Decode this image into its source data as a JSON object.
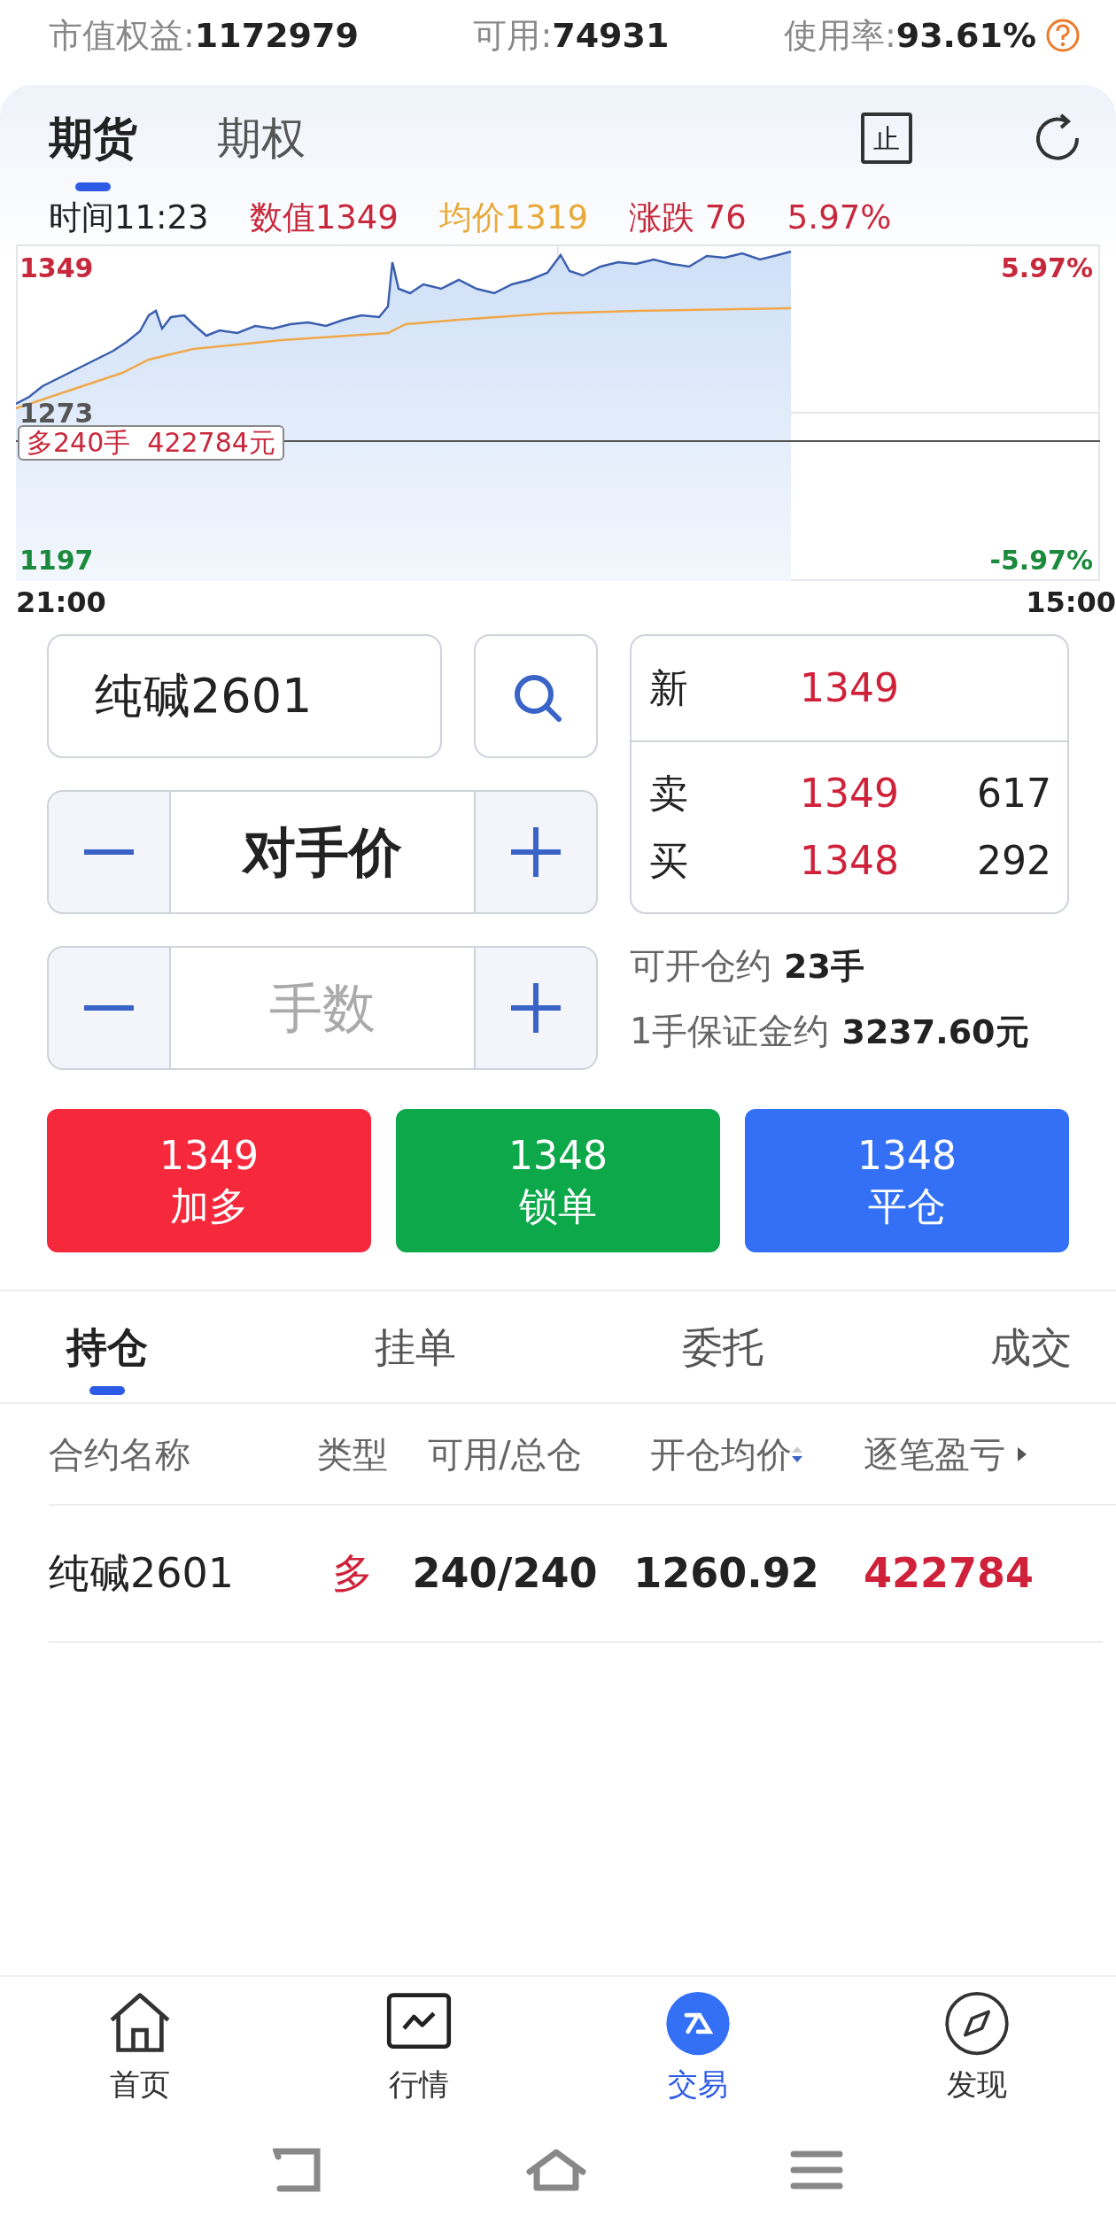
{
  "account_stats": [
    {
      "label": "市值权益:",
      "value": "1172979"
    },
    {
      "label": "可用:",
      "value": "74931"
    },
    {
      "label": "使用率:",
      "value": "93.61%"
    }
  ],
  "market_tabs": [
    {
      "label": "期货",
      "selected": true
    },
    {
      "label": "期权",
      "selected": false
    }
  ],
  "stop_icon_label": "止",
  "quote_line": [
    {
      "text": "时间11:23",
      "color": "#222222"
    },
    {
      "text": "数值1349",
      "color": "#c8283c"
    },
    {
      "text": "均价1319",
      "color": "#e8a93a"
    },
    {
      "text": "涨跌 76",
      "color": "#c8283c"
    },
    {
      "text": "5.97%",
      "color": "#c8283c"
    }
  ],
  "chart": {
    "high_price": "1349",
    "high_pct": "5.97%",
    "mid_price": "1273",
    "low_price": "1197",
    "low_pct": "-5.97%",
    "start_time": "21:00",
    "end_time": "15:00",
    "position_tag": "多240手  422784元"
  },
  "contract_field": {
    "value": "纯碱2601"
  },
  "order_book": [
    {
      "label": "新",
      "price": "1349"
    },
    {
      "label": "卖",
      "price": "1349",
      "volume": "617"
    },
    {
      "label": "买",
      "price": "1348",
      "volume": "292"
    }
  ],
  "price_stepper": {
    "value": "对手价"
  },
  "quantity_stepper": {
    "placeholder": "手数"
  },
  "open_info": {
    "label": "可开仓约",
    "value": "23手"
  },
  "margin_info": {
    "label": "1手保证金约",
    "value": "3237.60元"
  },
  "trade_buttons": [
    {
      "price": "1349",
      "label": "加多",
      "color": "#f5283c"
    },
    {
      "price": "1348",
      "label": "锁单",
      "color": "#0ca84a"
    },
    {
      "price": "1348",
      "label": "平仓",
      "color": "#3370f5"
    }
  ],
  "order_tabs": [
    {
      "label": "持仓",
      "selected": true
    },
    {
      "label": "挂单",
      "selected": false
    },
    {
      "label": "委托",
      "selected": false
    },
    {
      "label": "成交",
      "selected": false
    }
  ],
  "table": {
    "columns": [
      {
        "label": "合约名称"
      },
      {
        "label": "类型"
      },
      {
        "label": "可用/总仓"
      },
      {
        "label": "开仓均价",
        "sortable": true
      },
      {
        "label": "逐笔盈亏",
        "more": true
      }
    ],
    "rows": [
      {
        "contract": "纯碱2601",
        "type": "多",
        "available_total": "240/240",
        "avg_price": "1260.92",
        "pnl": "422784"
      }
    ]
  },
  "bottom_nav": [
    {
      "label": "首页",
      "selected": false
    },
    {
      "label": "行情",
      "selected": false
    },
    {
      "label": "交易",
      "selected": true
    },
    {
      "label": "发现",
      "selected": false
    }
  ]
}
